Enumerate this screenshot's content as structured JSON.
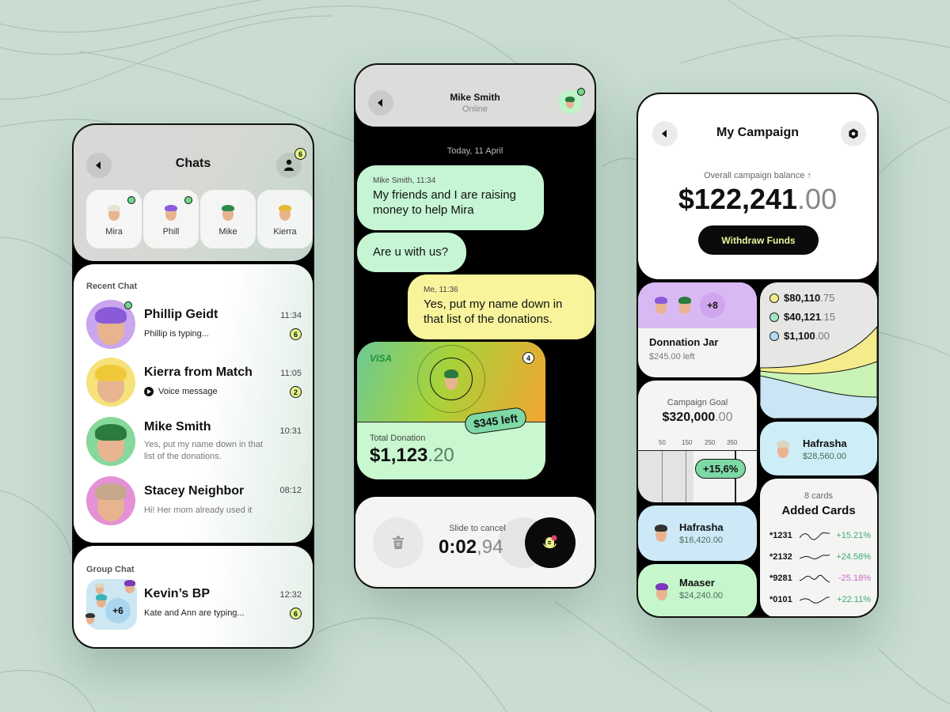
{
  "colors": {
    "background": "#c9ddd2",
    "online": "#6fd889",
    "badge": "#e3f58a",
    "bubble_incoming": "#c5f5d3",
    "bubble_outgoing": "#f7f49c",
    "withdraw_text": "#e9f59a",
    "positive": "#3aa872",
    "negative": "#c86cc0"
  },
  "chats_screen": {
    "title": "Chats",
    "back_icon": "chevron-left-icon",
    "contacts_icon": "user-icon",
    "contacts_badge": "6",
    "stories": [
      {
        "name": "Mira",
        "online": true
      },
      {
        "name": "Phill",
        "online": true
      },
      {
        "name": "Mike",
        "online": false
      },
      {
        "name": "Kierra",
        "online": false
      }
    ],
    "recent_label": "Recent Chat",
    "recent": [
      {
        "name": "Phillip Geidt",
        "message": "Phillip is typing...",
        "time": "11:34",
        "badge": "6",
        "online": true
      },
      {
        "name": "Kierra from Match",
        "message": "Voice message",
        "time": "11:05",
        "badge": "2",
        "online": false
      },
      {
        "name": "Mike Smith",
        "message": "Yes, put my name down in that list of the donations.",
        "time": "10:31",
        "badge": null,
        "online": false
      },
      {
        "name": "Stacey Neighbor",
        "message": "Hi! Her mom already used it",
        "time": "08:12",
        "badge": null,
        "online": false
      }
    ],
    "group_label": "Group Chat",
    "group": {
      "name": "Kevin’s BP",
      "message": "Kate and Ann are typing...",
      "time": "12:32",
      "badge": "6",
      "extra_members": "+6"
    }
  },
  "conversation_screen": {
    "contact_name": "Mike Smith",
    "contact_status": "Online",
    "date_label": "Today, 11 April",
    "messages": [
      {
        "sender": "Mike Smith, 11:34",
        "text": "My friends and I are raising money to help Mira"
      },
      {
        "sender": "",
        "text": "Are u with us?"
      },
      {
        "sender": "Me, 11:36",
        "text": "Yes, put my name down in that list of the donations."
      }
    ],
    "donation_card": {
      "brand": "VISA",
      "count_badge": "4",
      "left_label": "$345 left",
      "total_label": "Total Donation",
      "total_main": "$1,123",
      "total_decimal": ".20"
    },
    "recorder": {
      "hint": "Slide to cancel",
      "time_main": "0:02",
      "time_decimal": ",94",
      "delete_icon": "trash-icon",
      "mic_icon": "microphone-icon"
    }
  },
  "campaign_screen": {
    "title": "My Campaign",
    "settings_icon": "hexagon-settings-icon",
    "balance_label": "Overall campaign balance",
    "balance_trend_icon": "arrow-up-icon",
    "balance_main": "$122,241",
    "balance_decimal": ".00",
    "withdraw_label": "Withdraw Funds",
    "donation_jar": {
      "title": "Donnation Jar",
      "left": "$245.00 left",
      "extra_members": "+8"
    },
    "legend": [
      {
        "main": "$80,110",
        "decimal": ".75",
        "color": "#f4ec8c"
      },
      {
        "main": "$40,121",
        "decimal": ".15",
        "color": "#a4e6c2"
      },
      {
        "main": "$1,100",
        "decimal": ".00",
        "color": "#b6dcf2"
      }
    ],
    "goal": {
      "label": "Campaign Goal",
      "main": "$320,000",
      "decimal": ".00",
      "ticks": [
        "50",
        "150",
        "250",
        "350"
      ],
      "change": "+15,6%"
    },
    "donors": [
      {
        "name": "Hafrasha",
        "amount": "$28,560.00",
        "color": "#cdeef7"
      },
      {
        "name": "Hafrasha",
        "amount": "$16,420.00",
        "color": "#cde9f7"
      },
      {
        "name": "Maaser",
        "amount": "$24,240.00",
        "color": "#c6f7cc"
      }
    ],
    "added_cards": {
      "count_label": "8 cards",
      "title": "Added Cards",
      "cards": [
        {
          "number": "*1231",
          "change": "+15.21%",
          "positive": true
        },
        {
          "number": "*2132",
          "change": "+24.58%",
          "positive": true
        },
        {
          "number": "*9281",
          "change": "-25.18%",
          "positive": false
        },
        {
          "number": "*0101",
          "change": "+22.11%",
          "positive": true
        }
      ]
    }
  }
}
